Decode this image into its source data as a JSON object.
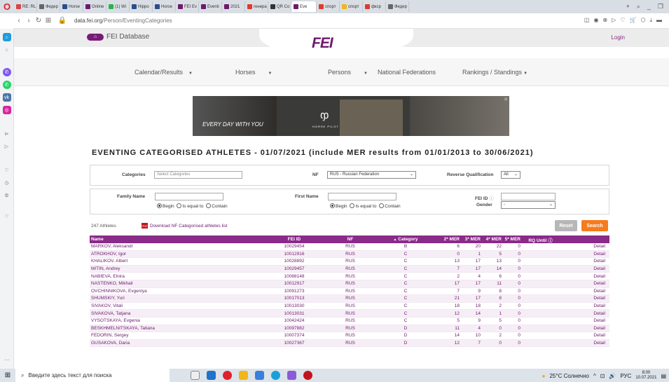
{
  "browser": {
    "tabs": [
      {
        "label": "RE: RL",
        "color": "#d44"
      },
      {
        "label": "Федер",
        "color": "#666"
      },
      {
        "label": "Horse",
        "color": "#2a4e8a"
      },
      {
        "label": "Online",
        "color": "#6d1a6c"
      },
      {
        "label": "(1) Wi",
        "color": "#2bb24c"
      },
      {
        "label": "Hippo",
        "color": "#2a4e8a"
      },
      {
        "label": "Horse",
        "color": "#2a4e8a"
      },
      {
        "label": "FEI Ev",
        "color": "#6d1a6c"
      },
      {
        "label": "Eventi",
        "color": "#6d1a6c"
      },
      {
        "label": "2021",
        "color": "#6d1a6c"
      },
      {
        "label": "генера",
        "color": "#e03a2a"
      },
      {
        "label": "QR Co",
        "color": "#333"
      },
      {
        "label": "Eve",
        "color": "#6d1a6c"
      },
      {
        "label": "спорт",
        "color": "#e03a2a"
      },
      {
        "label": "спорт",
        "color": "#f0b51f"
      },
      {
        "label": "фкср",
        "color": "#e03a2a"
      },
      {
        "label": "Федер",
        "color": "#666"
      }
    ],
    "active_tab_index": 12,
    "url_host": "data.fei.org",
    "url_path": "/Person/EventingCategories"
  },
  "header": {
    "db_label": "FEI Database",
    "logo": "FEI",
    "login": "Login"
  },
  "menu": [
    {
      "label": "Calendar/Results"
    },
    {
      "label": "Horses"
    },
    {
      "label": "Persons"
    },
    {
      "label": "National Federations"
    },
    {
      "label": "Rankings / Standings"
    }
  ],
  "banner": {
    "tagline": "EVERY DAY WITH YOU",
    "brand": "HORSE PILOT"
  },
  "page_title": "EVENTING CATEGORISED ATHLETES - 01/07/2021 (include MER results from 01/01/2013 to 30/06/2021)",
  "filters": {
    "categories_label": "Categories",
    "categories_placeholder": "Select Categories",
    "nf_label": "NF",
    "nf_value": "RUS - Russian Federation",
    "rq_label": "Reverse Qualification",
    "rq_value": "All",
    "family_label": "Family Name",
    "first_label": "First Name",
    "feiid_label": "FEI ID",
    "gender_label": "Gender",
    "gender_value": "-",
    "opt_begin": "Begin",
    "opt_equal": "Is equal to",
    "opt_contain": "Contain"
  },
  "toolbar": {
    "count": "247 Athletes",
    "download": "Download NF Categorised athletes list",
    "pdf": "PDF",
    "reset": "Reset",
    "search": "Search"
  },
  "table": {
    "headers": [
      "Name",
      "FEI ID",
      "NF",
      "Category",
      "2* MER",
      "3* MER",
      "4* MER",
      "5* MER",
      "RQ Until"
    ],
    "sort_glyph": "▲",
    "detail_label": "Detail",
    "rows": [
      [
        "MARKOV, Aleksandr",
        "10029454",
        "RUS",
        "B",
        "6",
        "20",
        "22",
        "0"
      ],
      [
        "ATROKHOV, Igor",
        "10012916",
        "RUS",
        "C",
        "0",
        "1",
        "5",
        "0"
      ],
      [
        "KHALIKOV, Albert",
        "10028892",
        "RUS",
        "C",
        "13",
        "17",
        "13",
        "0"
      ],
      [
        "MITIN, Andrey",
        "10029457",
        "RUS",
        "C",
        "7",
        "17",
        "14",
        "0"
      ],
      [
        "NABIEVA, Elnira",
        "10088148",
        "RUS",
        "C",
        "2",
        "4",
        "6",
        "0"
      ],
      [
        "NASTENKO, Mikhail",
        "10012917",
        "RUS",
        "C",
        "17",
        "17",
        "11",
        "0"
      ],
      [
        "OVCHINNIKOVA, Evgeniya",
        "10091273",
        "RUS",
        "C",
        "7",
        "9",
        "8",
        "0"
      ],
      [
        "SHUMSKIY, Yuri",
        "10017013",
        "RUS",
        "C",
        "21",
        "17",
        "8",
        "0"
      ],
      [
        "SIVAKOV, Vitali",
        "10013030",
        "RUS",
        "C",
        "18",
        "18",
        "2",
        "0"
      ],
      [
        "SIVAKOVA, Tatjana",
        "10013031",
        "RUS",
        "C",
        "12",
        "14",
        "1",
        "0"
      ],
      [
        "VYSOTSKAYA, Evgenia",
        "10042424",
        "RUS",
        "C",
        "5",
        "9",
        "5",
        "0"
      ],
      [
        "BESKHMELNITSKAYA, Tatiana",
        "10097882",
        "RUS",
        "D",
        "11",
        "4",
        "0",
        "0"
      ],
      [
        "FEDORIN, Sergey",
        "10007374",
        "RUS",
        "D",
        "14",
        "10",
        "2",
        "0"
      ],
      [
        "GUSAKOVA, Daria",
        "10027367",
        "RUS",
        "D",
        "12",
        "7",
        "0",
        "0"
      ]
    ]
  },
  "taskbar": {
    "search_placeholder": "Введите здесь текст для поиска",
    "weather": "25°C Солнечно",
    "lang": "РУС",
    "time": "8:00",
    "date": "10.07.2021"
  }
}
